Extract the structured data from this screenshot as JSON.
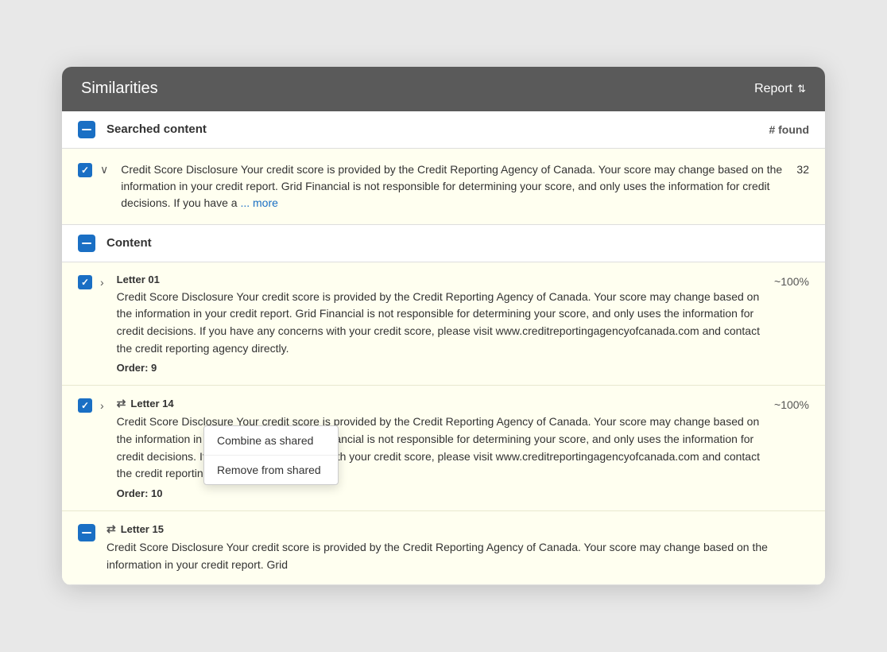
{
  "header": {
    "title": "Similarities",
    "report_label": "Report"
  },
  "searched_section": {
    "label": "Searched content",
    "found_label": "# found",
    "row": {
      "text": "Credit Score Disclosure Your credit score is provided by the Credit Reporting Agency of Canada. Your score may change based on the information in your credit report. Grid Financial is not responsible for determining your score, and only uses the information for credit decisions. If you have a",
      "link": "... more",
      "count": "32"
    }
  },
  "content_section": {
    "label": "Content",
    "items": [
      {
        "id": "item-1",
        "title": "Letter 01",
        "shared": false,
        "text": "Credit Score Disclosure Your credit score is provided by the Credit Reporting Agency of Canada. Your score may change based on the information in your credit report. Grid Financial is not responsible for determining your score, and only uses the information for credit decisions. If you have any concerns with your credit score, please visit www.creditreportingagencyofcanada.com and contact the credit reporting agency directly.",
        "order": "Order: 9",
        "similarity": "~100%"
      },
      {
        "id": "item-2",
        "title": "Letter 14",
        "shared": true,
        "text": "Credit Score Disclosure Your credit score is provided by the Credit Reporting Agency of Canada. Your score may change based on the information in your credit report. Grid Financial is not responsible for determining your score, and only uses the information for credit decisions. If you have any concerns with your credit score, please visit www.creditreportingagencyofcanada.com and contact the credit reporting agency directly.",
        "order": "Order: 10",
        "similarity": "~100%",
        "show_menu": true
      },
      {
        "id": "item-3",
        "title": "Letter 15",
        "shared": true,
        "text": "Credit Score Disclosure Your credit score is provided by the Credit Reporting Agency of Canada. Your score may change based on the information in your credit report. Grid",
        "order": "",
        "similarity": "",
        "show_menu": false
      }
    ]
  },
  "context_menu": {
    "items": [
      {
        "id": "combine",
        "label": "Combine as shared"
      },
      {
        "id": "remove",
        "label": "Remove from shared"
      }
    ]
  }
}
